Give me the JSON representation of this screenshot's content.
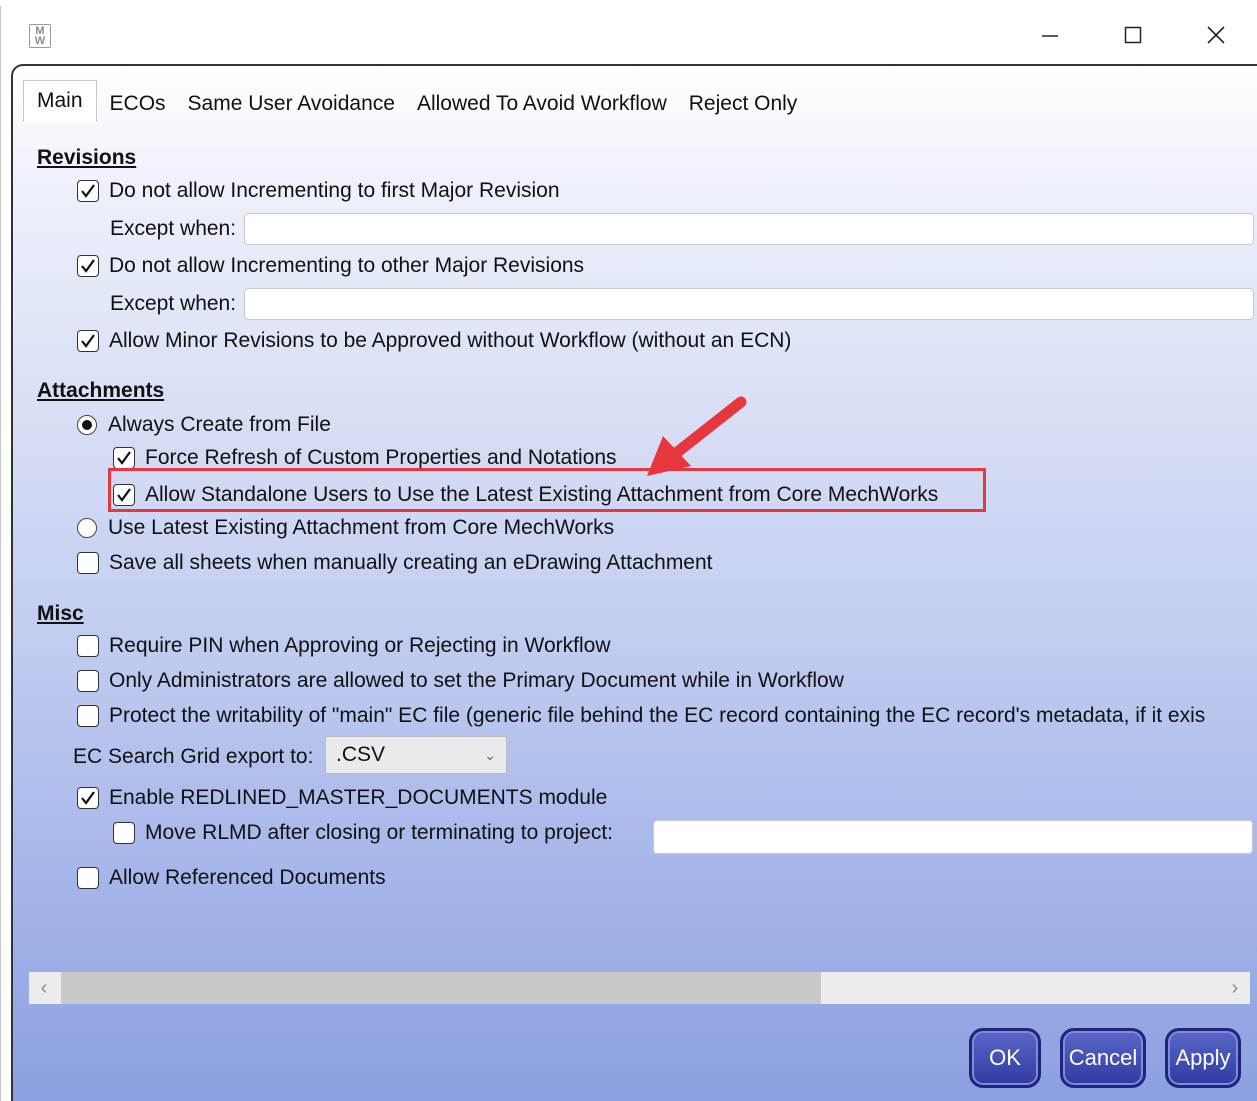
{
  "window": {
    "app_icon_text": "M\nW",
    "controls": {
      "minimize": "—",
      "maximize": "□",
      "close": "✕"
    }
  },
  "tabs": [
    {
      "label": "Main",
      "active": true
    },
    {
      "label": "ECOs",
      "active": false
    },
    {
      "label": "Same User Avoidance",
      "active": false
    },
    {
      "label": "Allowed To Avoid Workflow",
      "active": false
    },
    {
      "label": "Reject Only",
      "active": false
    }
  ],
  "revisions": {
    "title": "Revisions",
    "first_major": {
      "label": "Do not allow Incrementing to first Major Revision",
      "checked": true
    },
    "except_label_1": "Except when:",
    "except_value_1": "",
    "other_major": {
      "label": "Do not allow Incrementing to other Major Revisions",
      "checked": true
    },
    "except_label_2": "Except when:",
    "except_value_2": "",
    "minor": {
      "label": "Allow Minor Revisions to be Approved without Workflow (without an ECN)",
      "checked": true
    }
  },
  "attachments": {
    "title": "Attachments",
    "always_create": {
      "label": "Always Create from File",
      "selected": true
    },
    "force_refresh": {
      "label": "Force Refresh of Custom Properties and Notations",
      "checked": true
    },
    "allow_standalone": {
      "label": "Allow Standalone Users to Use the Latest Existing Attachment from Core MechWorks",
      "checked": true
    },
    "use_latest": {
      "label": "Use Latest Existing Attachment from Core MechWorks",
      "selected": false
    },
    "save_sheets": {
      "label": "Save all sheets when manually creating an eDrawing Attachment",
      "checked": false
    }
  },
  "misc": {
    "title": "Misc",
    "require_pin": {
      "label": "Require PIN when Approving or Rejecting in Workflow",
      "checked": false
    },
    "only_admins": {
      "label": "Only Administrators are allowed to set the Primary Document while in Workflow",
      "checked": false
    },
    "protect": {
      "label": "Protect the writability of \"main\" EC file (generic file behind the EC record containing the EC record's metadata, if it exis",
      "checked": false
    },
    "export_label": "EC Search Grid export to:",
    "export_value": ".CSV",
    "redlined": {
      "label": "Enable REDLINED_MASTER_DOCUMENTS module",
      "checked": true
    },
    "move_rlmd": {
      "label": "Move RLMD after closing or terminating to project:",
      "checked": false
    },
    "move_rlmd_value": "",
    "referenced": {
      "label": "Allow Referenced Documents",
      "checked": false
    }
  },
  "scrollbar": {
    "left_arrow": "‹",
    "right_arrow": "›"
  },
  "buttons": {
    "ok": "OK",
    "cancel": "Cancel",
    "apply": "Apply"
  },
  "colors": {
    "highlight": "#e8363f",
    "annotation_arrow": "#e8363f",
    "button_bg": "#2f3aa0",
    "gradient_bottom": "#8b9fe0"
  }
}
